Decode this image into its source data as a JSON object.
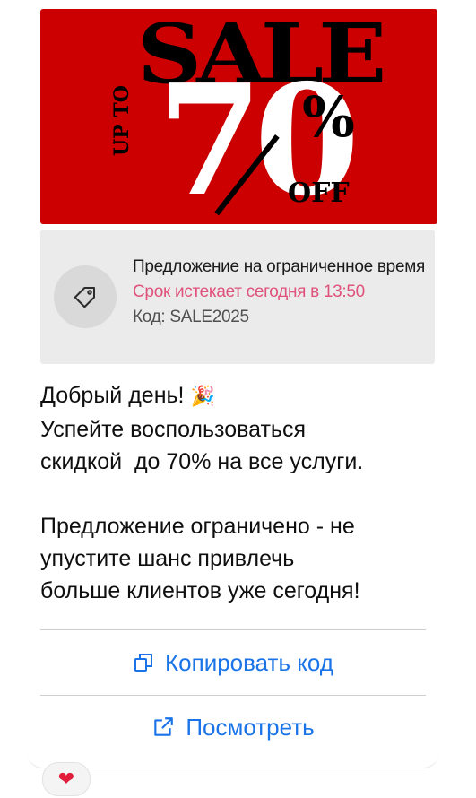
{
  "banner": {
    "word": "SALE",
    "up_to": "UP TO",
    "percent_number": "70",
    "percent_sign": "%",
    "off": "OFF"
  },
  "promo": {
    "icon": "tag-icon",
    "title": "Предложение на ограниченное время",
    "expiry": "Срок истекает сегодня в 13:50",
    "code": "Код: SALE2025"
  },
  "message": {
    "greeting": "Добрый день!",
    "greeting_emoji": "🎉",
    "line1": "Успейте воспользоваться\nскидкой  до 70% на все услуги.",
    "line2": "Предложение ограничено - не\nупустите шанс привлечь\nбольше клиентов уже сегодня!"
  },
  "actions": {
    "copy_label": "Копировать код",
    "copy_icon": "copy-icon",
    "view_label": "Посмотреть",
    "view_icon": "external-link-icon"
  },
  "reaction": {
    "emoji": "❤",
    "icon": "heart-icon"
  },
  "colors": {
    "banner_bg": "#cc0000",
    "expiry": "#e0527b",
    "link": "#1a74e8"
  }
}
